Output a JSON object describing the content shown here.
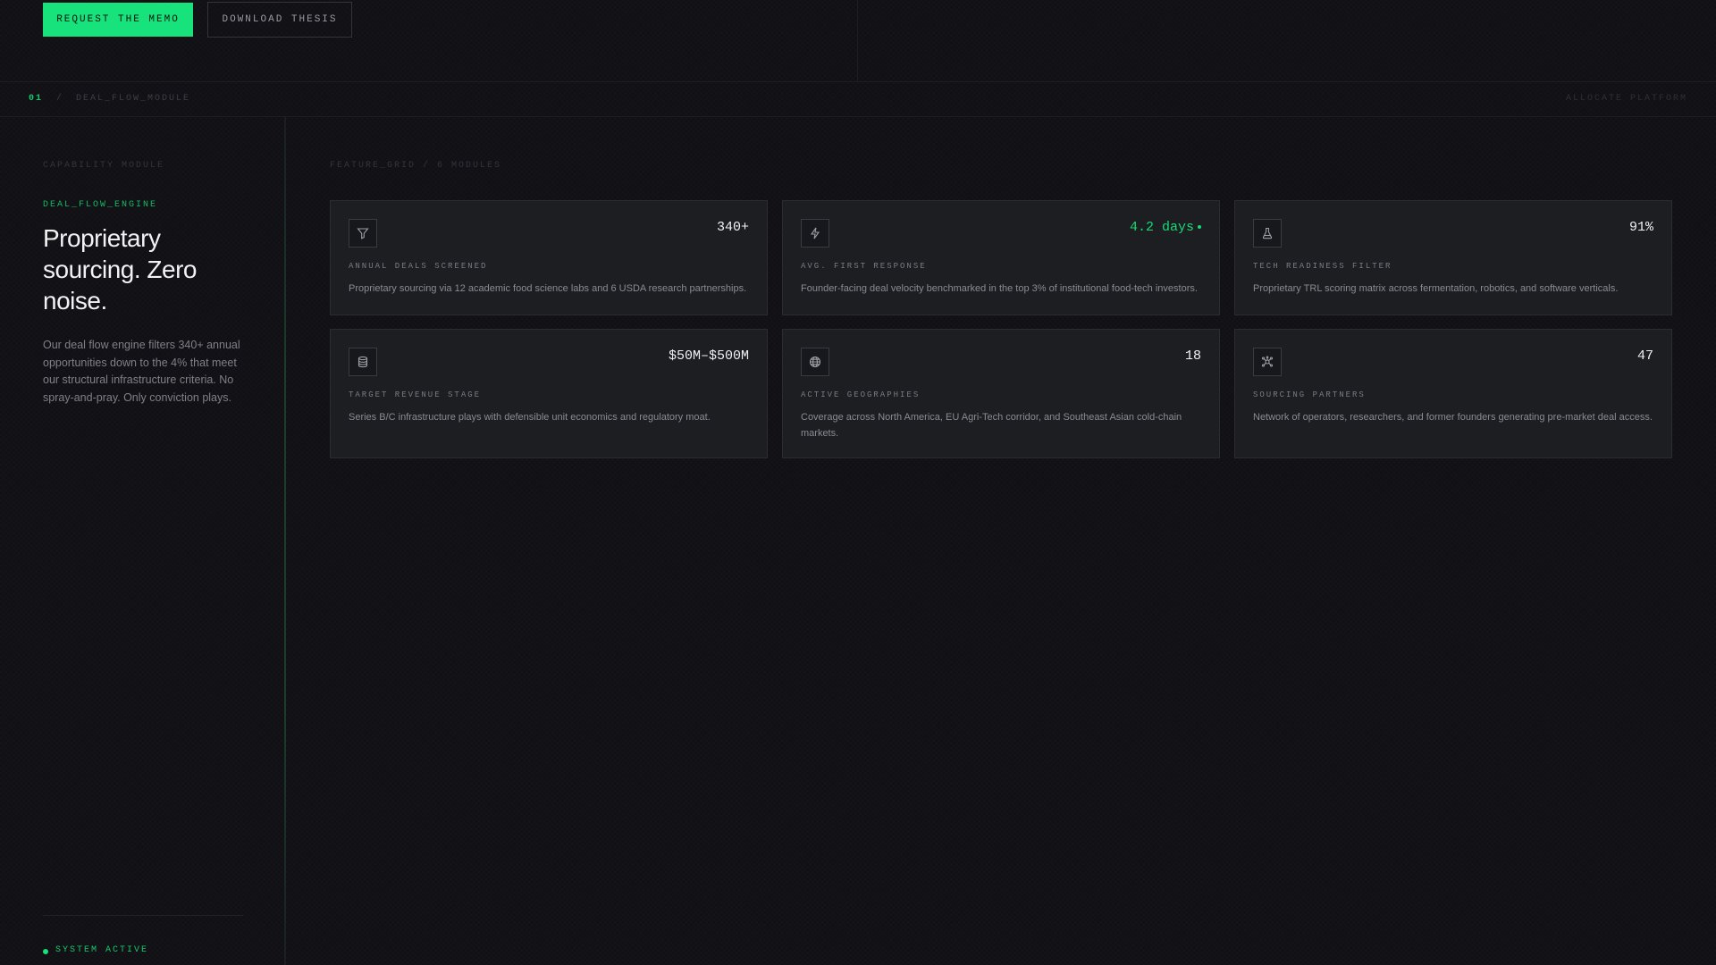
{
  "header": {
    "primary_button": "REQUEST THE MEMO",
    "secondary_button": "DOWNLOAD THESIS"
  },
  "breadcrumb": {
    "index": "01",
    "separator": "/",
    "path": "DEAL_FLOW_MODULE",
    "right": "ALLOCATE PLATFORM"
  },
  "sidebar": {
    "label": "CAPABILITY MODULE",
    "engine": "DEAL_FLOW_ENGINE",
    "title": "Proprietary sourcing. Zero noise.",
    "description": "Our deal flow engine filters 340+ annual opportunities down to the 4% that meet our structural infrastructure criteria. No spray-and-pray. Only conviction plays.",
    "status": "SYSTEM ACTIVE"
  },
  "grid": {
    "label": "FEATURE_GRID / 6 MODULES",
    "cards": [
      {
        "icon": "filter-icon",
        "metric": "340+",
        "label": "ANNUAL DEALS SCREENED",
        "description": "Proprietary sourcing via 12 academic food science labs and 6 USDA research partnerships."
      },
      {
        "icon": "lightning-icon",
        "metric": "4.2 days",
        "label": "AVG. FIRST RESPONSE",
        "description": "Founder-facing deal velocity benchmarked in the top 3% of institutional food-tech investors."
      },
      {
        "icon": "flask-icon",
        "metric": "91%",
        "label": "TECH READINESS FILTER",
        "description": "Proprietary TRL scoring matrix across fermentation, robotics, and software verticals."
      },
      {
        "icon": "database-icon",
        "metric": "$50M–$500M",
        "label": "TARGET REVENUE STAGE",
        "description": "Series B/C infrastructure plays with defensible unit economics and regulatory moat."
      },
      {
        "icon": "globe-icon",
        "metric": "18",
        "label": "ACTIVE GEOGRAPHIES",
        "description": "Coverage across North America, EU Agri-Tech corridor, and Southeast Asian cold-chain markets."
      },
      {
        "icon": "network-icon",
        "metric": "47",
        "label": "SOURCING PARTNERS",
        "description": "Network of operators, researchers, and former founders generating pre-market deal access."
      }
    ]
  },
  "colors": {
    "accent": "#17e27c",
    "background": "#111115",
    "card": "#1d1e22"
  }
}
